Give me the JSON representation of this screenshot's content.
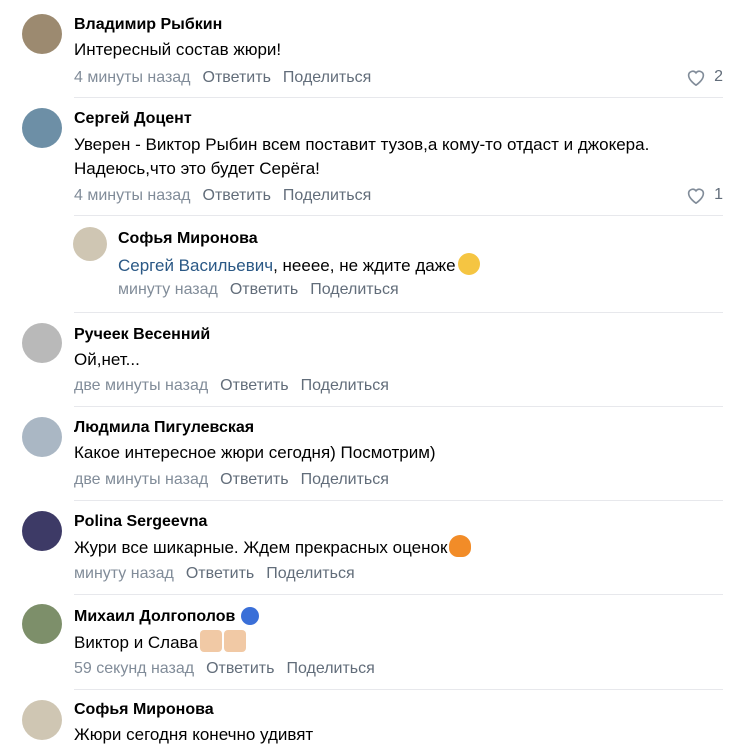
{
  "comments": [
    {
      "name": "Владимир Рыбкин",
      "text": "Интересный состав жюри!",
      "time": "4 минуты назад",
      "likes": "2"
    },
    {
      "name": "Сергей Доцент",
      "text1": "Уверен - Виктор Рыбин всем поставит тузов,а кому-то отдаст и джокера.",
      "text2": "Надеюсь,что это будет Серёга!",
      "time": "4 минуты назад",
      "likes": "1"
    },
    {
      "name": "Софья Миронова",
      "mention": "Сергей Васильевич",
      "text": ", нееее, не ждите даже",
      "time": "минуту назад"
    },
    {
      "name": "Ручеек Весенний",
      "text": "Ой,нет...",
      "time": "две минуты назад"
    },
    {
      "name": "Людмила Пигулевская",
      "text": "Какое интересное жюри сегодня) Посмотрим)",
      "time": "две минуты назад"
    },
    {
      "name": "Polina Sergeevna",
      "text": "Жури все шикарные. Ждем прекрасных оценок",
      "time": "минуту назад"
    },
    {
      "name": "Михаил Долгополов",
      "text": "Виктор и Слава",
      "time": "59 секунд назад"
    },
    {
      "name": "Софья Миронова",
      "text": "Жюри сегодня конечно удивят"
    }
  ],
  "actions": {
    "reply": "Ответить",
    "share": "Поделиться"
  },
  "colors": {
    "meta": "#818c99",
    "action": "#626d7a",
    "link": "#2a5885",
    "divider": "#e7e8ec"
  }
}
